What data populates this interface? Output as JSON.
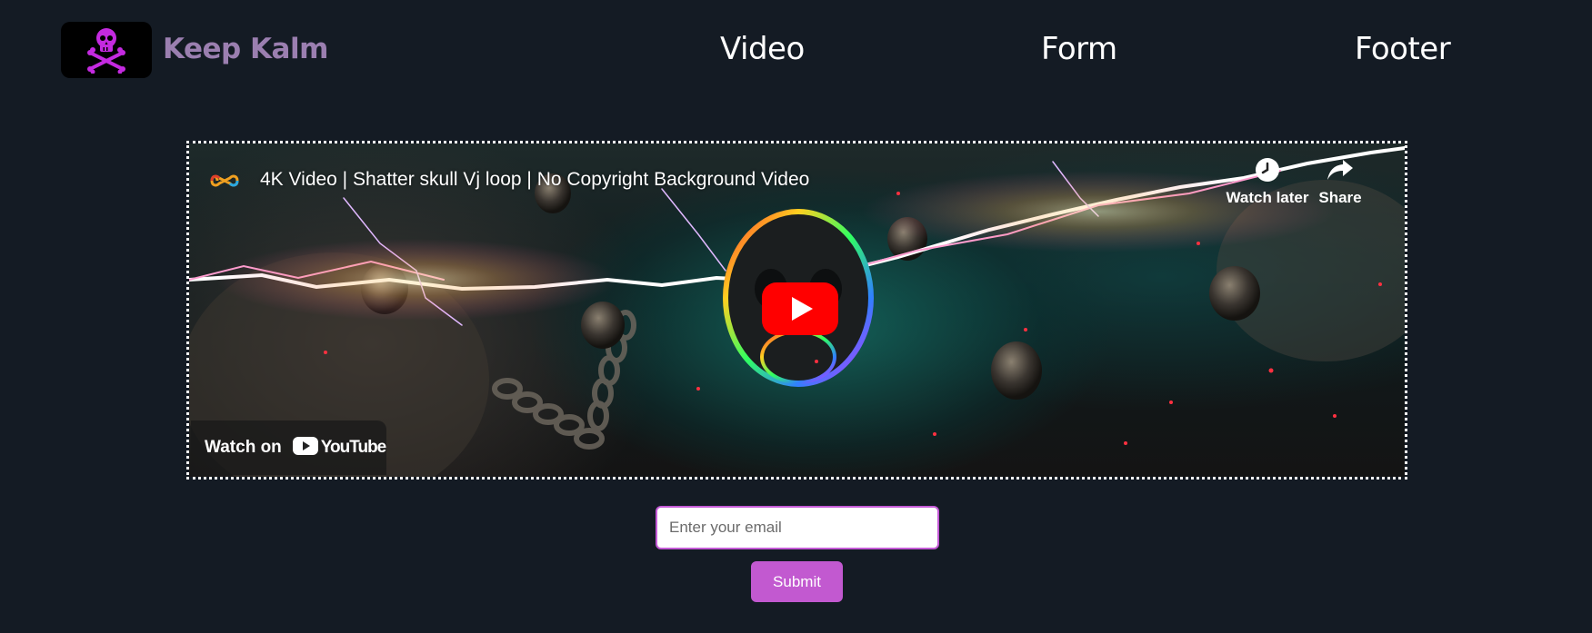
{
  "header": {
    "brand": "Keep Kalm",
    "logo_icon": "skull-crossbones-icon",
    "nav": [
      {
        "label": "Video"
      },
      {
        "label": "Form"
      },
      {
        "label": "Footer"
      }
    ]
  },
  "video": {
    "title": "4K Video | Shatter skull Vj loop | No Copyright Background Video",
    "channel_icon": "infinity-logo-icon",
    "watch_later_label": "Watch later",
    "share_label": "Share",
    "watch_on_label": "Watch on",
    "youtube_label": "YouTube"
  },
  "form": {
    "email_placeholder": "Enter your email",
    "submit_label": "Submit"
  },
  "colors": {
    "background": "#141b24",
    "brand": "#9b7fb0",
    "accent": "#c259d0",
    "youtube_red": "#ff0000"
  }
}
